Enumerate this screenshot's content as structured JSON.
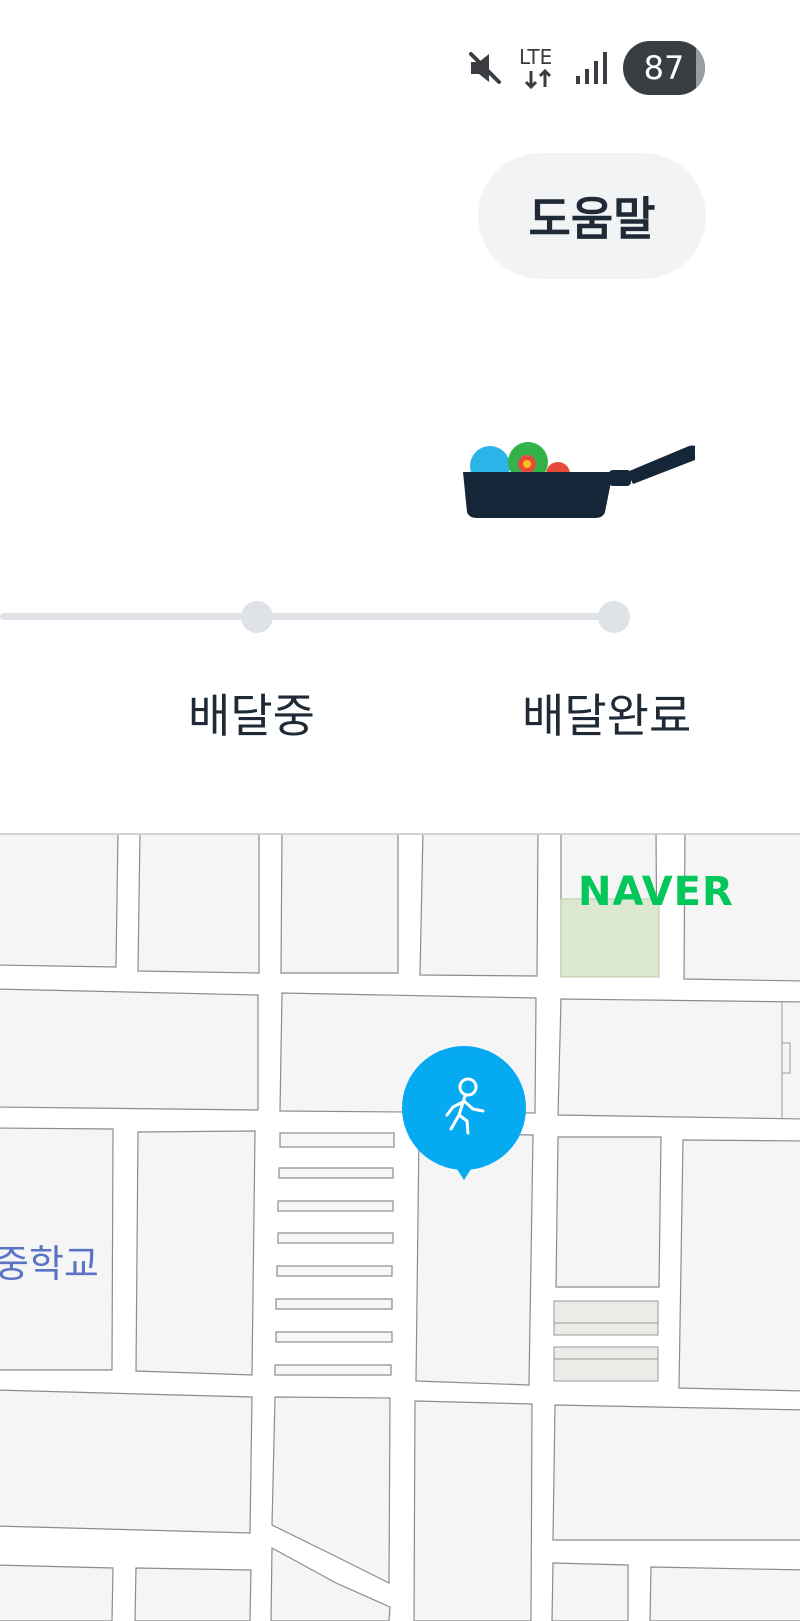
{
  "status_bar": {
    "mute_icon": "mute-icon",
    "network": "LTE",
    "signal_icon": "signal-icon",
    "battery": "87"
  },
  "header": {
    "help_label": "도움말"
  },
  "progress": {
    "illustration_icon": "frying-pan-icon",
    "steps": [
      {
        "label": "배달중"
      },
      {
        "label": "배달완료"
      }
    ]
  },
  "map": {
    "logo": "NAVER",
    "place_label": "중학교",
    "rider_marker_icon": "walking-person-icon",
    "colors": {
      "marker": "#06aaf0",
      "logo": "#03c75a",
      "park": "#dce8d0"
    }
  }
}
